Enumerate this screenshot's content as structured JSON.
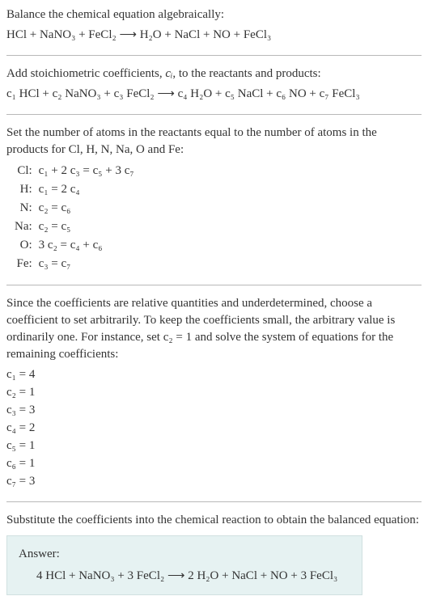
{
  "s1": {
    "intro": "Balance the chemical equation algebraically:",
    "eqn": "HCl + NaNO₃ + FeCl₂  ⟶  H₂O + NaCl + NO + FeCl₃"
  },
  "s2": {
    "intro_a": "Add stoichiometric coefficients, ",
    "ci": "cᵢ",
    "intro_b": ", to the reactants and products:",
    "eqn": "c₁ HCl + c₂ NaNO₃ + c₃ FeCl₂  ⟶  c₄ H₂O + c₅ NaCl + c₆ NO + c₇ FeCl₃"
  },
  "s3": {
    "intro": "Set the number of atoms in the reactants equal to the number of atoms in the products for Cl, H, N, Na, O and Fe:",
    "rows": [
      {
        "el": "Cl:",
        "eq": "c₁ + 2 c₃ = c₅ + 3 c₇"
      },
      {
        "el": "H:",
        "eq": "c₁ = 2 c₄"
      },
      {
        "el": "N:",
        "eq": "c₂ = c₆"
      },
      {
        "el": "Na:",
        "eq": "c₂ = c₅"
      },
      {
        "el": "O:",
        "eq": "3 c₂ = c₄ + c₆"
      },
      {
        "el": "Fe:",
        "eq": "c₃ = c₇"
      }
    ]
  },
  "s4": {
    "intro_a": "Since the coefficients are relative quantities and underdetermined, choose a coefficient to set arbitrarily. To keep the coefficients small, the arbitrary value is ordinarily one. For instance, set ",
    "c2": "c₂ = 1",
    "intro_b": " and solve the system of equations for the remaining coefficients:",
    "coeffs": [
      "c₁ = 4",
      "c₂ = 1",
      "c₃ = 3",
      "c₄ = 2",
      "c₅ = 1",
      "c₆ = 1",
      "c₇ = 3"
    ]
  },
  "s5": {
    "intro": "Substitute the coefficients into the chemical reaction to obtain the balanced equation:",
    "answer_label": "Answer:",
    "answer_eqn": "4 HCl + NaNO₃ + 3 FeCl₂  ⟶  2 H₂O + NaCl + NO + 3 FeCl₃"
  }
}
